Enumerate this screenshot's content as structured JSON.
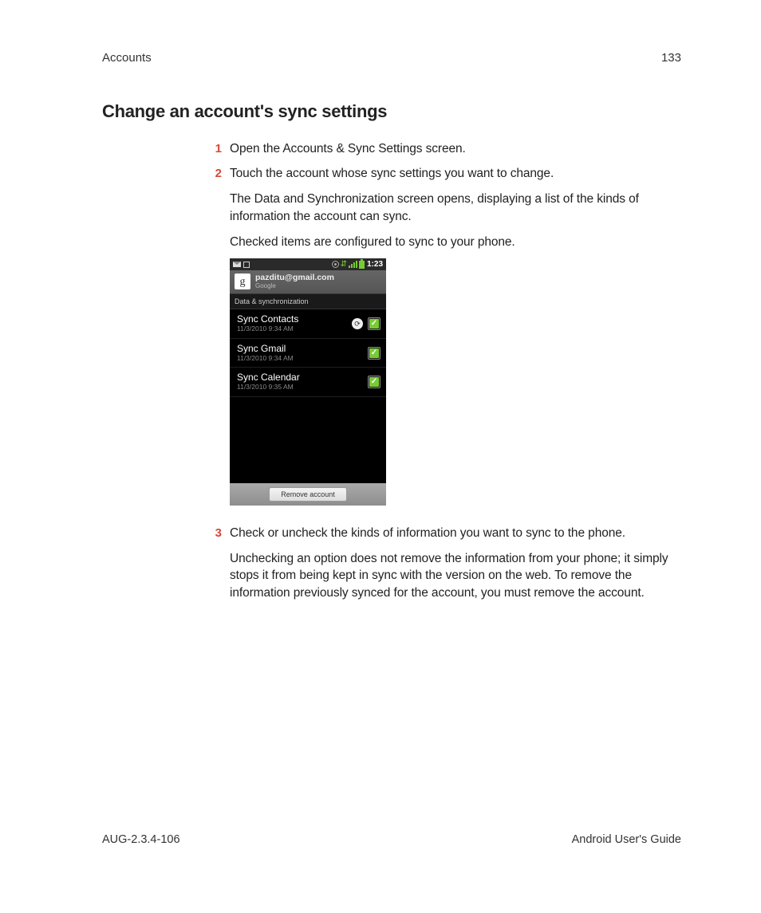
{
  "header": {
    "section": "Accounts",
    "page_number": "133"
  },
  "title": "Change an account's sync settings",
  "steps": [
    {
      "num": "1",
      "paras": [
        "Open the Accounts & Sync Settings screen."
      ]
    },
    {
      "num": "2",
      "paras": [
        "Touch the account whose sync settings you want to change.",
        "The Data and Synchronization screen opens, displaying a list of the kinds of information the account can sync.",
        "Checked items are configured to sync to your phone."
      ]
    },
    {
      "num": "3",
      "paras": [
        "Check or uncheck the kinds of information you want to sync to the phone.",
        "Unchecking an option does not remove the information from your phone; it simply stops it from being kept in sync with the version on the web. To remove the information previously synced for the account, you must remove the account."
      ]
    }
  ],
  "phone": {
    "time": "1:23",
    "g_glyph": "g",
    "email": "pazditu@gmail.com",
    "acct_type": "Google",
    "section": "Data & synchronization",
    "rows": [
      {
        "title": "Sync Contacts",
        "sub": "11/3/2010 9:34 AM",
        "spinning": true
      },
      {
        "title": "Sync Gmail",
        "sub": "11/3/2010 9:34 AM",
        "spinning": false
      },
      {
        "title": "Sync Calendar",
        "sub": "11/3/2010 9:35 AM",
        "spinning": false
      }
    ],
    "remove_label": "Remove account",
    "check_glyph": "✓",
    "spin_glyph": "⟳"
  },
  "footer": {
    "left": "AUG-2.3.4-106",
    "right": "Android User's Guide"
  }
}
